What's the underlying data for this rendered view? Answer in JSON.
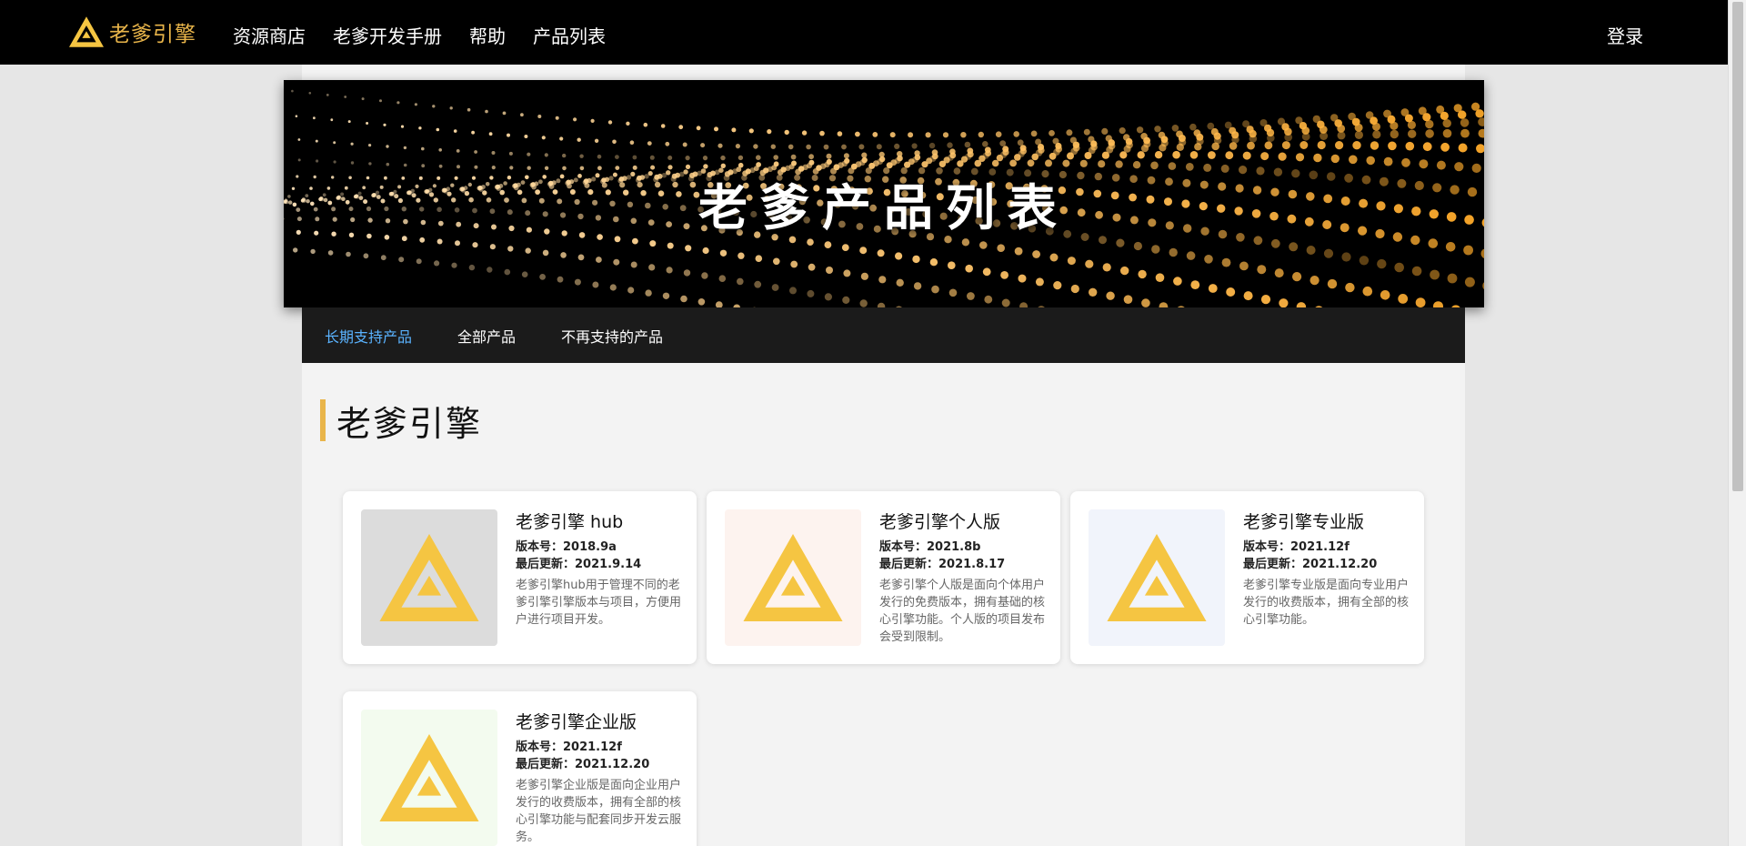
{
  "header": {
    "brand": "老爹引擎",
    "nav": [
      "资源商店",
      "老爹开发手册",
      "帮助",
      "产品列表"
    ],
    "login": "登录"
  },
  "banner": {
    "title": "老爹产品列表"
  },
  "tabs": [
    {
      "label": "长期支持产品",
      "active": true
    },
    {
      "label": "全部产品",
      "active": false
    },
    {
      "label": "不再支持的产品",
      "active": false
    }
  ],
  "section": {
    "title": "老爹引擎"
  },
  "products": [
    {
      "name": "老爹引擎 hub",
      "version": "版本号：2018.9a",
      "updated": "最后更新：2021.9.14",
      "description": "老爹引擎hub用于管理不同的老爹引擎引擎版本与项目，方便用户进行项目开发。",
      "thumb_bg": "#dcdcdc"
    },
    {
      "name": "老爹引擎个人版",
      "version": "版本号：2021.8b",
      "updated": "最后更新：2021.8.17",
      "description": "老爹引擎个人版是面向个体用户发行的免费版本，拥有基础的核心引擎功能。个人版的项目发布会受到限制。",
      "thumb_bg": "#fdf3ef"
    },
    {
      "name": "老爹引擎专业版",
      "version": "版本号：2021.12f",
      "updated": "最后更新：2021.12.20",
      "description": "老爹引擎专业版是面向专业用户发行的收费版本，拥有全部的核心引擎功能。",
      "thumb_bg": "#f1f4fb"
    },
    {
      "name": "老爹引擎企业版",
      "version": "版本号：2021.12f",
      "updated": "最后更新：2021.12.20",
      "description": "老爹引擎企业版是面向企业用户发行的收费版本，拥有全部的核心引擎功能与配套同步开发云服务。",
      "thumb_bg": "#f3fbef"
    }
  ],
  "colors": {
    "accent": "#e9b54a",
    "logo": "#f5c542",
    "active_tab": "#5ab3ff"
  },
  "icons": {
    "brand": "triangle-logo-icon"
  }
}
